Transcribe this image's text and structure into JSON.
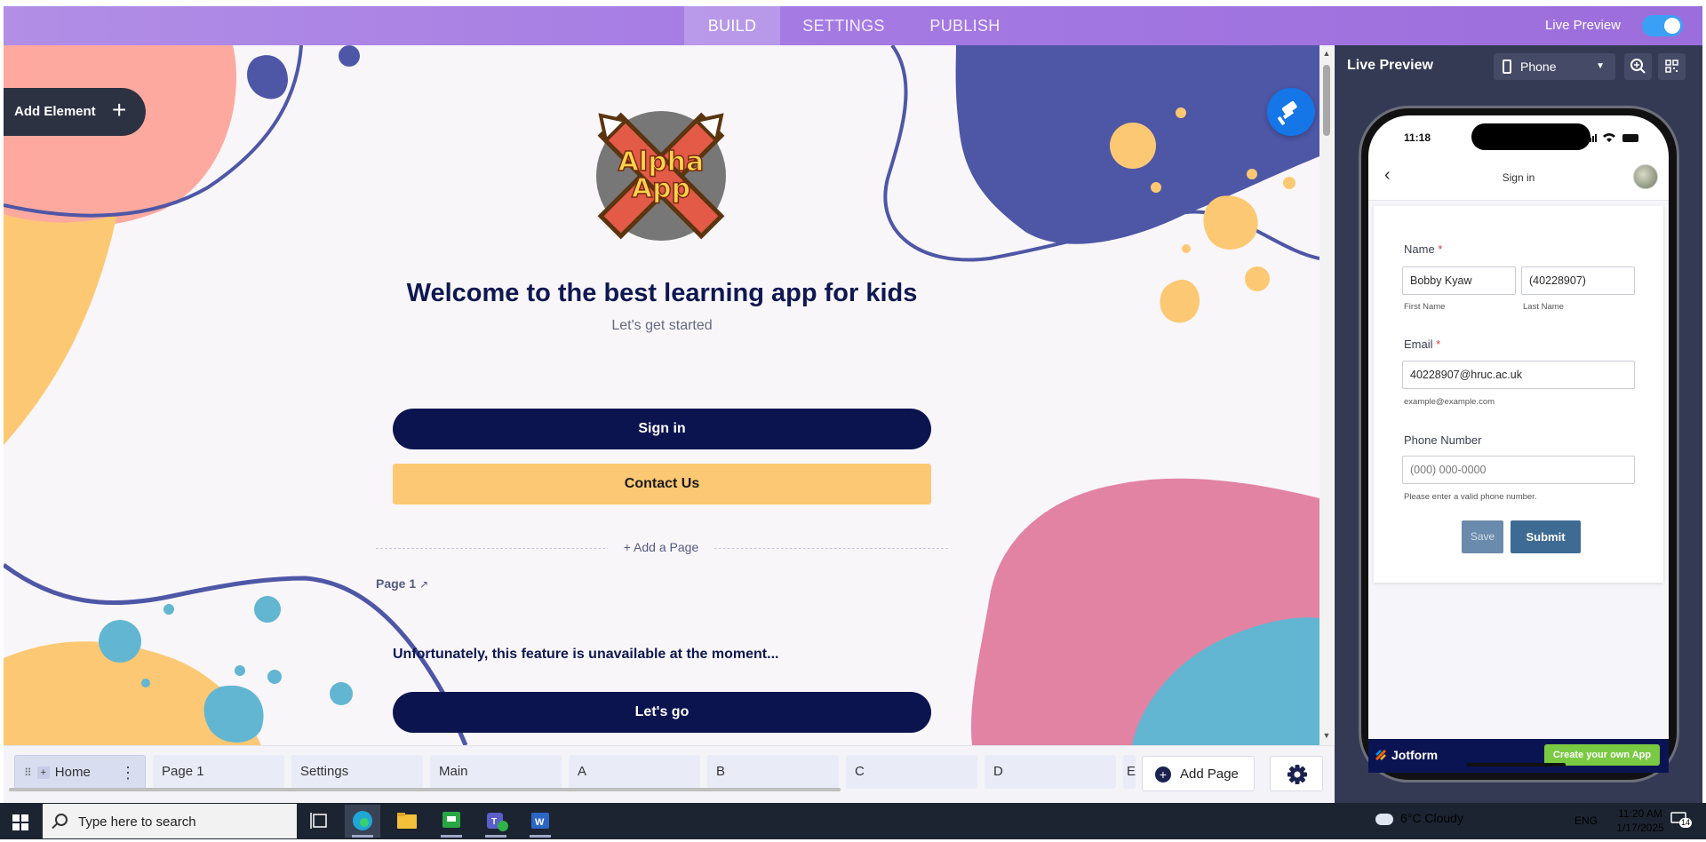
{
  "topbar": {
    "tabs": [
      "BUILD",
      "SETTINGS",
      "PUBLISH"
    ],
    "active_tab": "BUILD",
    "live_preview_label": "Live Preview",
    "live_preview_on": true,
    "accent_color": "#a57be3"
  },
  "builder": {
    "add_element_label": "Add Element",
    "logo_text": "Alpha App",
    "welcome_title": "Welcome to the best learning app for kids",
    "welcome_subtitle": "Let's get started",
    "sign_in_button": "Sign in",
    "contact_button": "Contact Us",
    "add_a_page_label": "+ Add a Page",
    "page1_label": "Page 1",
    "unavailable_text": "Unfortunately, this feature is unavailable at the moment...",
    "lets_go_button": "Let's go",
    "primary_color": "#0c1450",
    "secondary_color": "#fdc873"
  },
  "page_tabs": {
    "tabs": [
      "Home",
      "Page 1",
      "Settings",
      "Main",
      "A",
      "B",
      "C",
      "D",
      "E"
    ],
    "active_tab": "Home",
    "add_page_label": "Add Page"
  },
  "preview": {
    "title": "Live Preview",
    "device": "Phone",
    "status_time": "11:18",
    "screen_title": "Sign in",
    "form": {
      "name_label": "Name",
      "first_name_value": "Bobby Kyaw",
      "last_name_value": "(40228907)",
      "first_name_sub": "First Name",
      "last_name_sub": "Last Name",
      "email_label": "Email",
      "email_value": "40228907@hruc.ac.uk",
      "email_hint": "example@example.com",
      "phone_label": "Phone Number",
      "phone_placeholder": "(000) 000-0000",
      "phone_hint": "Please enter a valid phone number.",
      "required_mark": "*",
      "save_button": "Save",
      "submit_button": "Submit"
    },
    "footer_brand": "Jotform",
    "footer_cta": "Create your own App"
  },
  "taskbar": {
    "search_placeholder": "Type here to search",
    "weather": "6°C  Cloudy",
    "language": "ENG",
    "time": "11:20 AM",
    "date": "1/17/2025",
    "notification_count": "14",
    "teams_badge": "1"
  }
}
